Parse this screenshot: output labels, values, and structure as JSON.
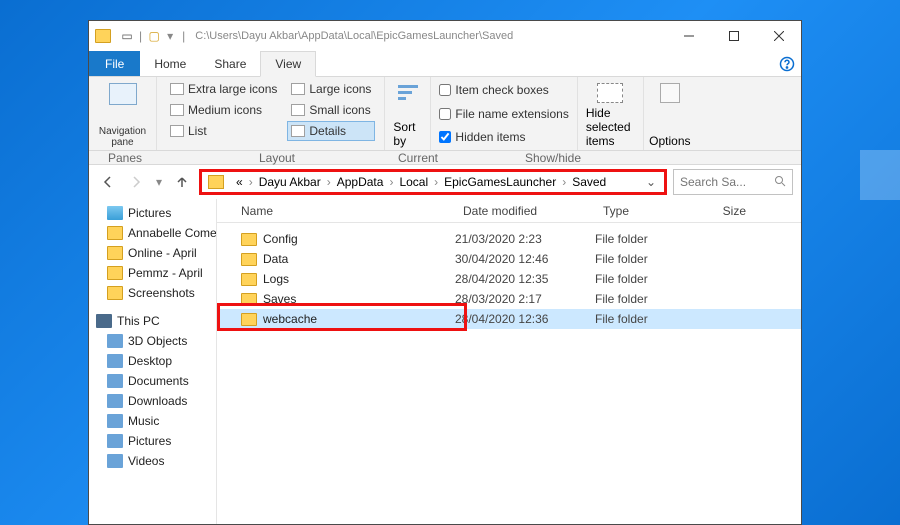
{
  "title_path": "C:\\Users\\Dayu Akbar\\AppData\\Local\\EpicGamesLauncher\\Saved",
  "tabs": {
    "file": "File",
    "home": "Home",
    "share": "Share",
    "view": "View"
  },
  "ribbon": {
    "navpane": "Navigation pane",
    "panes": "Panes",
    "layout": "Layout",
    "currentview": "Current view",
    "showhide": "Show/hide",
    "xl": "Extra large icons",
    "lg": "Large icons",
    "md": "Medium icons",
    "sm": "Small icons",
    "list": "List",
    "details": "Details",
    "sort": "Sort by",
    "check_boxes": "Item check boxes",
    "ext": "File name extensions",
    "hidden": "Hidden items",
    "hide_sel": "Hide selected items",
    "options": "Options"
  },
  "breadcrumb": {
    "prefix": "«",
    "parts": [
      "Dayu Akbar",
      "AppData",
      "Local",
      "EpicGamesLauncher",
      "Saved"
    ]
  },
  "search_placeholder": "Search Sa...",
  "tree": {
    "pictures": "Pictures",
    "items1": [
      "Annabelle Come",
      "Online - April",
      "Pemmz - April",
      "Screenshots"
    ],
    "thispc": "This PC",
    "items2": [
      "3D Objects",
      "Desktop",
      "Documents",
      "Downloads",
      "Music",
      "Pictures",
      "Videos"
    ]
  },
  "columns": {
    "name": "Name",
    "date": "Date modified",
    "type": "Type",
    "size": "Size"
  },
  "rows": [
    {
      "name": "Config",
      "date": "21/03/2020 2:23",
      "type": "File folder"
    },
    {
      "name": "Data",
      "date": "30/04/2020 12:46",
      "type": "File folder"
    },
    {
      "name": "Logs",
      "date": "28/04/2020 12:35",
      "type": "File folder"
    },
    {
      "name": "Saves",
      "date": "28/03/2020 2:17",
      "type": "File folder"
    },
    {
      "name": "webcache",
      "date": "28/04/2020 12:36",
      "type": "File folder"
    }
  ]
}
